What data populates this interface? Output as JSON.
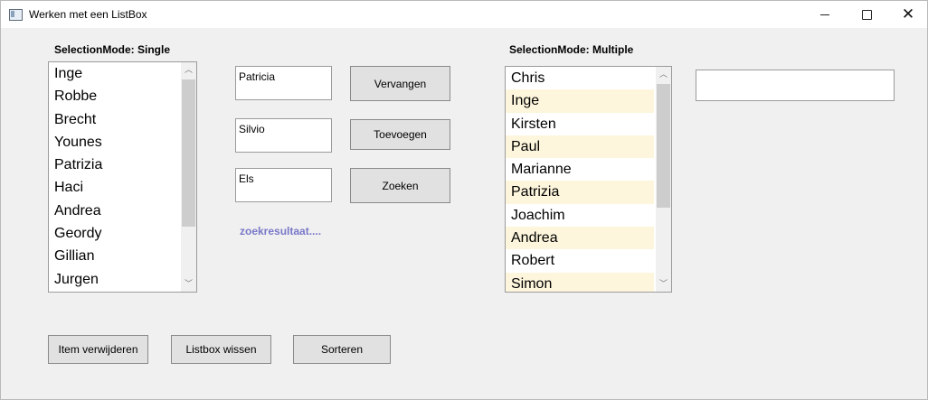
{
  "window": {
    "title": "Werken met een ListBox",
    "icon": "app-window-icon",
    "controls": {
      "minimize": "minimize-icon",
      "maximize": "maximize-icon",
      "close": "close-icon"
    }
  },
  "single": {
    "label": "SelectionMode: Single",
    "items": [
      "Inge",
      "Robbe",
      "Brecht",
      "Younes",
      "Patrizia",
      "Haci",
      "Andrea",
      "Geordy",
      "Gillian",
      "Jurgen"
    ]
  },
  "inputs": {
    "replace_value": "Patricia",
    "add_value": "Silvio",
    "search_value": "Els"
  },
  "buttons": {
    "replace": "Vervangen",
    "add": "Toevoegen",
    "search": "Zoeken",
    "remove_item": "Item verwijderen",
    "clear_listbox": "Listbox wissen",
    "sort": "Sorteren"
  },
  "search_result": "zoekresultaat....",
  "multiple": {
    "label": "SelectionMode: Multiple",
    "items": [
      {
        "text": "Chris",
        "selected": false
      },
      {
        "text": "Inge",
        "selected": true
      },
      {
        "text": "Kirsten",
        "selected": false
      },
      {
        "text": "Paul",
        "selected": true
      },
      {
        "text": "Marianne",
        "selected": false
      },
      {
        "text": "Patrizia",
        "selected": true
      },
      {
        "text": "Joachim",
        "selected": false
      },
      {
        "text": "Andrea",
        "selected": true
      },
      {
        "text": "Robert",
        "selected": false
      },
      {
        "text": "Simon",
        "selected": true
      }
    ],
    "selected_color": "#fdf5dc"
  },
  "multi_output_value": ""
}
